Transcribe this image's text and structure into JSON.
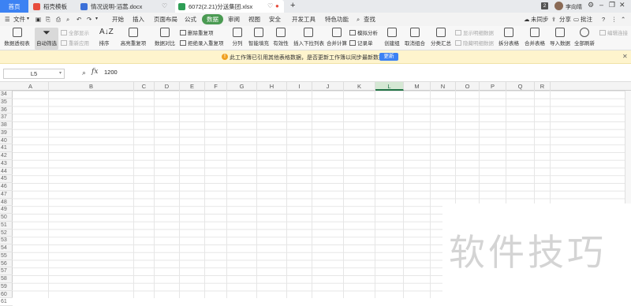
{
  "titlebar": {
    "home_tab": "首页",
    "tabs": [
      {
        "label": "稻壳模板",
        "icon": "daoke-icon",
        "color": "#e74c3c"
      },
      {
        "label": "情况说明-滔蒿.docx",
        "icon": "word-icon",
        "color": "#3b6fd8"
      },
      {
        "label": "6072(2.21)分送集团.xlsx",
        "icon": "excel-icon",
        "color": "#2e9e55",
        "active": true
      }
    ],
    "new_tab": "+",
    "badge": "2",
    "user": "李向晴"
  },
  "menubar": {
    "file": "文件",
    "items": [
      "开始",
      "插入",
      "页面布局",
      "公式",
      "数据",
      "审阅",
      "视图",
      "安全",
      "开发工具",
      "特色功能"
    ],
    "active": "数据",
    "search": "查找",
    "right": [
      "未同步",
      "分享",
      "批注"
    ]
  },
  "ribbon": {
    "pivot": "数据透视表",
    "autofilter": "自动筛选",
    "show_all": "全部显示",
    "reapply": "重新应用",
    "sort": "排序",
    "highlight_dup": "高亮重复项",
    "data_compare": "数据对比",
    "delete_dup": "删除重复项",
    "reject_dup": "拒绝录入重复项",
    "split": "分列",
    "smart_fill": "智能填充",
    "validity": "有效性",
    "dropdown": "插入下拉列表",
    "consolidate": "合并计算",
    "simulate": "模拟分析",
    "record": "记录单",
    "group": "创建组",
    "ungroup": "取消组合",
    "subtotal": "分类汇总",
    "show_detail": "显示明细数据",
    "hide_detail": "隐藏明细数据",
    "split_table": "拆分表格",
    "merge_table": "合并表格",
    "import": "导入数据",
    "refresh_all": "全部刷新",
    "edit_link": "编辑连接"
  },
  "notice": {
    "text": "此工作簿已引用其他表格数据，是否更新工作簿以同步最新数据？",
    "button": "更新",
    "color": "#fef4cd"
  },
  "formula": {
    "namebox": "L5",
    "fx": "fx",
    "value": "1200"
  },
  "grid": {
    "columns": [
      "A",
      "B",
      "C",
      "D",
      "E",
      "F",
      "G",
      "H",
      "I",
      "J",
      "K",
      "L",
      "M",
      "N",
      "O",
      "P",
      "Q",
      "R"
    ],
    "selected_column": "L",
    "rows": [
      "34",
      "35",
      "36",
      "37",
      "38",
      "39",
      "40",
      "41",
      "42",
      "43",
      "44",
      "45",
      "46",
      "47",
      "48",
      "49",
      "50",
      "51",
      "52",
      "53",
      "54",
      "55",
      "56",
      "57",
      "58",
      "59",
      "60",
      "61"
    ]
  },
  "watermark": "软件技巧"
}
